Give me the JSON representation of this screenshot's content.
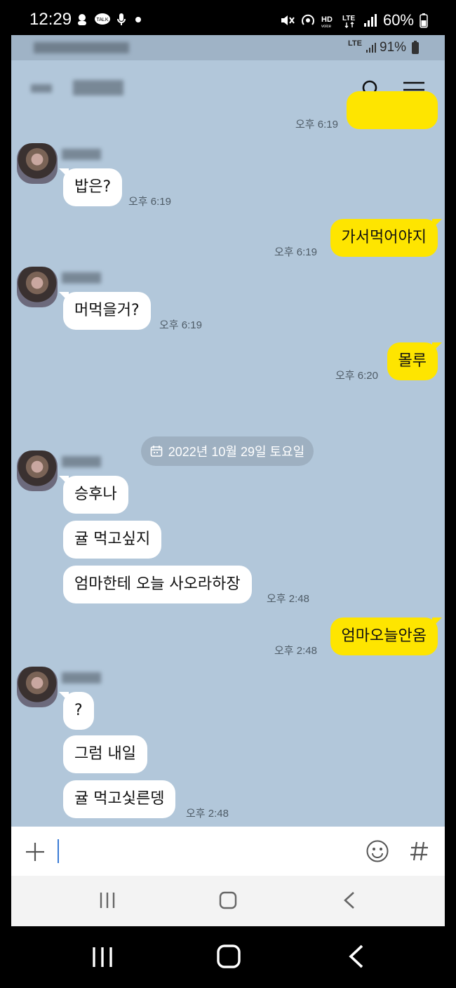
{
  "status_bar": {
    "time": "12:29",
    "battery": "60%",
    "icons": [
      "notification-icon",
      "talk-icon",
      "mic-icon",
      "dot-icon",
      "mute-icon",
      "hotspot-icon",
      "hd-voice-icon",
      "lte-icon",
      "signal-icon",
      "battery-icon"
    ]
  },
  "inner_status": {
    "battery": "91%",
    "network": "LTE"
  },
  "header": {
    "icons": [
      "search-icon",
      "menu-icon"
    ]
  },
  "messages": {
    "m0_time": "오후 6:19",
    "m1_text": "밥은?",
    "m1_time": "오후 6:19",
    "m2_text": "가서먹어야지",
    "m2_time": "오후 6:19",
    "m3_text": "머먹을거?",
    "m3_time": "오후 6:19",
    "m4_text": "몰루",
    "m4_time": "오후 6:20",
    "date": "2022년 10월 29일 토요일",
    "m5_text": "승후나",
    "m6_text": "귤 먹고싶지",
    "m7_text": "엄마한테 오늘 사오라하장",
    "m7_time": "오후 2:48",
    "m8_text": "엄마오늘안옴",
    "m8_time": "오후 2:48",
    "m9_text": "?",
    "m10_text": "그럼 내일",
    "m11_text": "귤 먹고싳른뎅",
    "m11_time": "오후 2:48"
  },
  "input": {
    "placeholder": "",
    "icons": [
      "plus-icon",
      "emoji-icon",
      "hash-icon"
    ]
  },
  "colors": {
    "chat_bg": "#b2c7da",
    "outgoing": "#fee500",
    "incoming": "#ffffff"
  }
}
